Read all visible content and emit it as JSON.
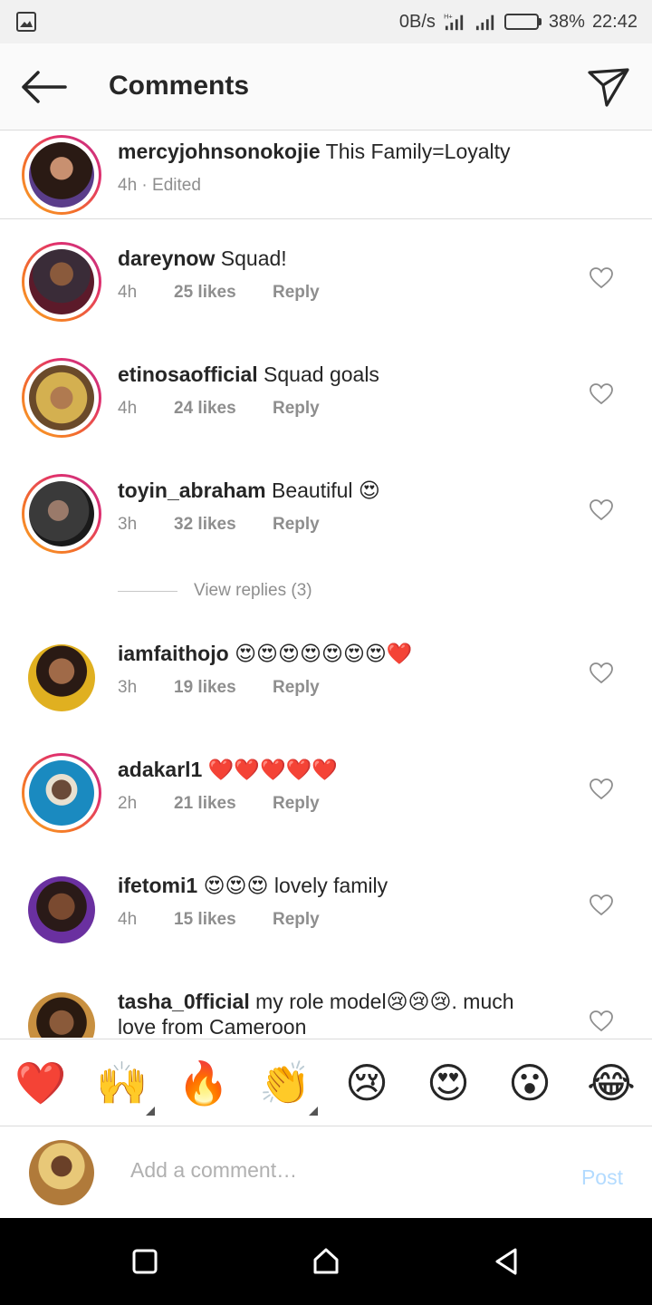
{
  "status_bar": {
    "net_speed": "0B/s",
    "network_type": "H+",
    "battery_percent_text": "38%",
    "battery_level": 0.38,
    "time": "22:42"
  },
  "header": {
    "title": "Comments"
  },
  "caption": {
    "username": "mercyjohnsonokojie",
    "text": "This Family=Loyalty",
    "meta": "4h · Edited"
  },
  "comments": [
    {
      "username": "dareynow",
      "text": "Squad!",
      "time": "4h",
      "likes": "25 likes",
      "reply": "Reply"
    },
    {
      "username": "etinosaofficial",
      "text": "Squad goals",
      "time": "4h",
      "likes": "24 likes",
      "reply": "Reply"
    },
    {
      "username": "toyin_abraham",
      "text": "Beautiful 😍",
      "time": "3h",
      "likes": "32 likes",
      "reply": "Reply"
    },
    {
      "username": "iamfaithojo",
      "text": "😍😍😍😍😍😍😍❤️",
      "time": "3h",
      "likes": "19 likes",
      "reply": "Reply"
    },
    {
      "username": "adakarl1",
      "text": "❤️❤️❤️❤️❤️",
      "time": "2h",
      "likes": "21 likes",
      "reply": "Reply"
    },
    {
      "username": "ifetomi1",
      "text": "😍😍😍 lovely family",
      "time": "4h",
      "likes": "15 likes",
      "reply": "Reply"
    },
    {
      "username": "tasha_0fficial",
      "text": "my role model😢😢😢. much love from Cameroon"
    }
  ],
  "view_replies": "View replies (3)",
  "reactions": [
    "❤️",
    "🙌",
    "🔥",
    "👏",
    "😢",
    "😍",
    "😮",
    "😂"
  ],
  "input": {
    "placeholder": "Add a comment…",
    "post_label": "Post"
  },
  "colors": {
    "accent_disabled": "#b3dbff",
    "meta_gray": "#8e8e8e",
    "text": "#262626"
  }
}
